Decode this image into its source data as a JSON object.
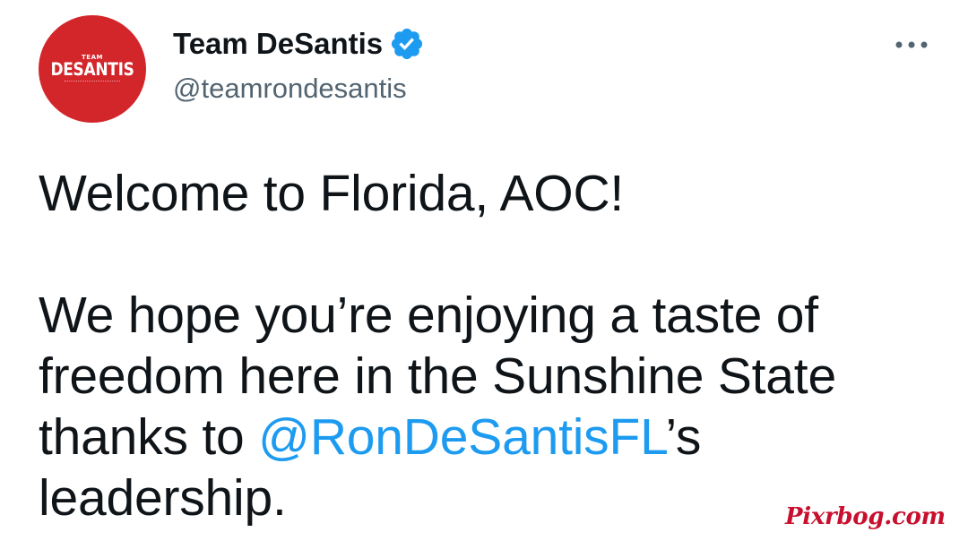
{
  "tweet": {
    "author": {
      "display_name": "Team DeSantis",
      "handle": "@teamrondesantis",
      "verified": true,
      "avatar": {
        "logo_top": "TEAM",
        "logo_main": "DESANTIS",
        "background_color": "#d3262b"
      }
    },
    "text": {
      "line1": "Welcome to Florida, AOC!",
      "line2": "We hope you’re enjoying a taste of",
      "line3": "freedom here in the Sunshine State",
      "line4_prefix": "thanks to ",
      "mention": "@RonDeSantisFL",
      "line4_suffix": "’s",
      "line5": "leadership."
    },
    "more_icon": "more-horizontal-icon"
  },
  "watermark": "Pixrbog.com",
  "colors": {
    "text": "#0f1419",
    "secondary_text": "#536471",
    "link": "#1d9bf0",
    "verified_badge": "#1d9bf0",
    "watermark": "#c8102e"
  }
}
